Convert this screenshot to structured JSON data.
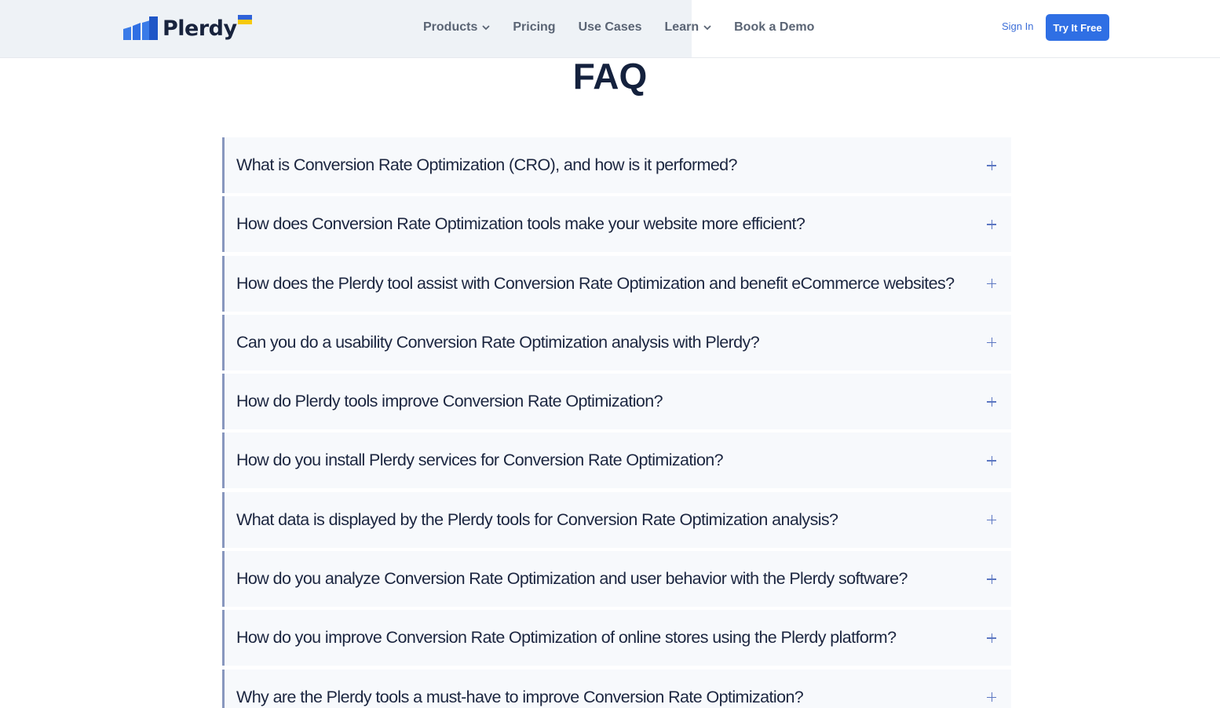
{
  "header": {
    "logo_text": "Plerdy",
    "nav": [
      {
        "label": "Products",
        "has_dropdown": true
      },
      {
        "label": "Pricing",
        "has_dropdown": false
      },
      {
        "label": "Use Cases",
        "has_dropdown": false
      },
      {
        "label": "Learn",
        "has_dropdown": true
      },
      {
        "label": "Book a Demo",
        "has_dropdown": false
      }
    ],
    "sign_in": "Sign In",
    "cta": "Try It Free"
  },
  "faq": {
    "title": "FAQ",
    "items": [
      {
        "question": "What is Conversion Rate Optimization (CRO), and how is it performed?"
      },
      {
        "question": "How does Conversion Rate Optimization tools make your website more efficient?"
      },
      {
        "question": "How does the Plerdy tool assist with Conversion Rate Optimization and benefit eCommerce websites?"
      },
      {
        "question": "Can you do a usability Conversion Rate Optimization analysis with Plerdy?"
      },
      {
        "question": "How do Plerdy tools improve Conversion Rate Optimization?"
      },
      {
        "question": "How do you install Plerdy services for Conversion Rate Optimization?"
      },
      {
        "question": "What data is displayed by the Plerdy tools for Conversion Rate Optimization analysis?"
      },
      {
        "question": "How do you analyze Conversion Rate Optimization and user behavior with the Plerdy software?"
      },
      {
        "question": "How do you improve Conversion Rate Optimization of online stores using the Plerdy platform?"
      },
      {
        "question": "Why are the Plerdy tools a must-have to improve Conversion Rate Optimization?"
      }
    ]
  },
  "colors": {
    "brand_blue": "#2f6fe4",
    "heading": "#14213d",
    "faq_border": "#8897be",
    "plus_icon": "#5c77c2"
  }
}
